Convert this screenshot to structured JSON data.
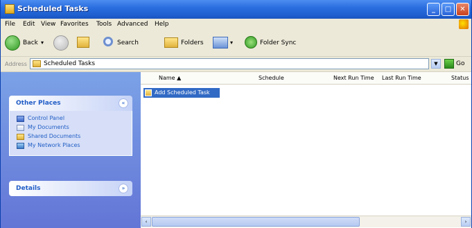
{
  "window": {
    "title": "Scheduled Tasks",
    "buttons": {
      "minimize": "_",
      "maximize": "□",
      "close": "✕"
    }
  },
  "menu": [
    "File",
    "Edit",
    "View",
    "Favorites",
    "Tools",
    "Advanced",
    "Help"
  ],
  "toolbar": {
    "back_label": "Back",
    "search_label": "Search",
    "folders_label": "Folders",
    "sync_label": "Folder Sync"
  },
  "address": {
    "label": "Address",
    "value": "Scheduled Tasks",
    "go_label": "Go"
  },
  "sidebar": {
    "panels": [
      {
        "title": "Other Places",
        "collapse": "«",
        "items": [
          {
            "label": "Control Panel",
            "icon": "control-panel-icon"
          },
          {
            "label": "My Documents",
            "icon": "documents-icon"
          },
          {
            "label": "Shared Documents",
            "icon": "shared-folder-icon"
          },
          {
            "label": "My Network Places",
            "icon": "network-icon"
          }
        ]
      },
      {
        "title": "Details",
        "collapse": "»"
      }
    ]
  },
  "table": {
    "columns": [
      "Name",
      "Schedule",
      "Next Run Time",
      "Last Run Time",
      "Status"
    ],
    "sort_indicator": "▲",
    "rows": [
      {
        "name": "Add Scheduled Task",
        "selected": true
      }
    ]
  },
  "scrollbar": {
    "left": "‹",
    "right": "›"
  },
  "colors": {
    "titlebar": "#2a6ee0",
    "sidebar": "#6f8ee0",
    "selection": "#316ac5",
    "link": "#215dc6"
  }
}
